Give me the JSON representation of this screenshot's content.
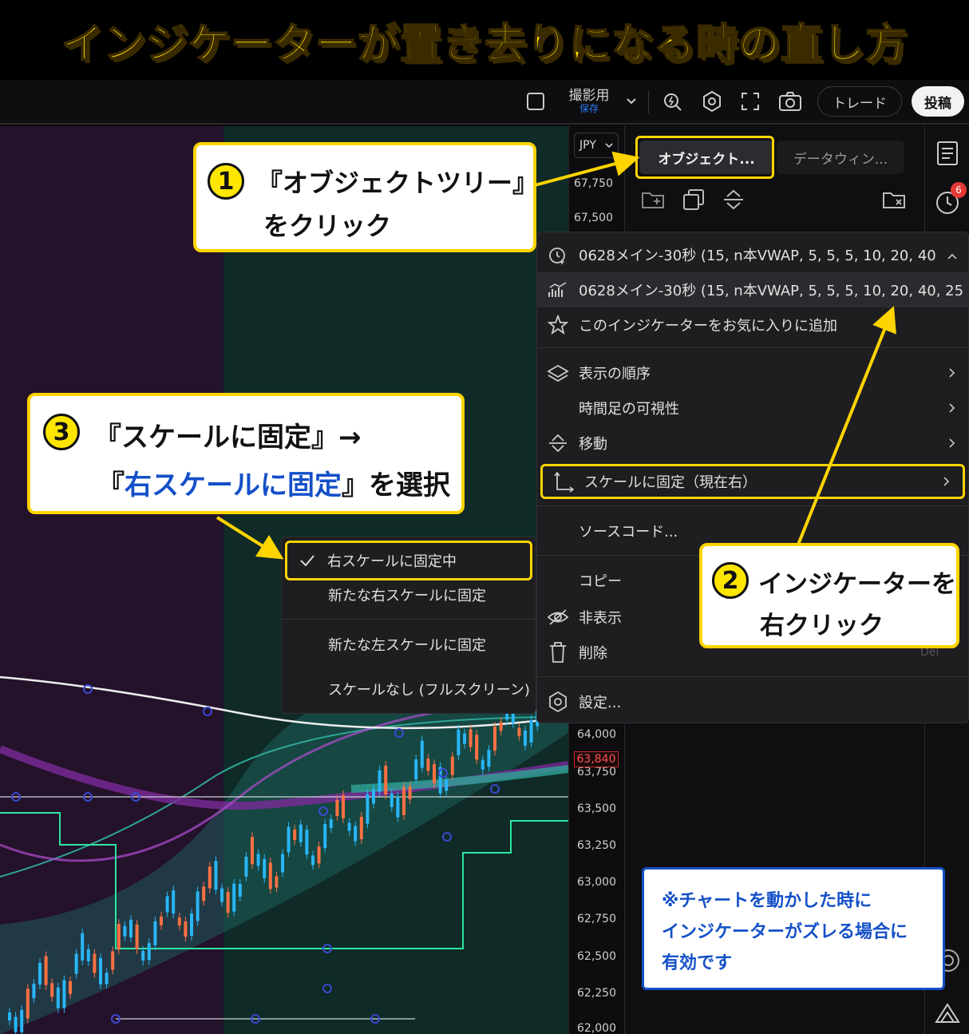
{
  "banner": {
    "title": "インジケーターが置き去りになる時の直し方"
  },
  "topbar": {
    "layout_name": "撮影用",
    "layout_status": "保存",
    "trade_label": "トレード",
    "post_label": "投稿"
  },
  "price_axis": {
    "currency": "JPY",
    "ticks": [
      "67,750",
      "67,500",
      "64,000",
      "63,750",
      "63,500",
      "63,250",
      "63,000",
      "62,750",
      "62,500",
      "62,250",
      "62,000"
    ],
    "current_price": "63,840"
  },
  "panel": {
    "tab_object_tree": "オブジェクト...",
    "tab_data_window": "データウィン..."
  },
  "sidebar": {
    "alert_badge": "6"
  },
  "context_menu": {
    "header_item": "0628メイン-30秒 (15, n本VWAP, 5, 5, 5, 10, 20, 40,",
    "items": [
      {
        "label": "0628メイン-30秒 (15, n本VWAP, 5, 5, 5, 10, 20, 40, 25",
        "icon": "indicator-icon"
      },
      {
        "label": "このインジケーターをお気に入りに追加",
        "icon": "star-icon"
      },
      {
        "label": "表示の順序",
        "icon": "layers-icon"
      },
      {
        "label": "時間足の可視性",
        "icon": ""
      },
      {
        "label": "移動",
        "icon": "move-icon"
      },
      {
        "label": "スケールに固定（現在右）",
        "icon": "pin-scale-icon"
      },
      {
        "label": "ソースコード...",
        "icon": ""
      },
      {
        "label": "コピー",
        "icon": ""
      },
      {
        "label": "非表示",
        "icon": "eye-off-icon"
      },
      {
        "label": "削除",
        "icon": "trash-icon"
      },
      {
        "label": "設定...",
        "icon": "settings-icon"
      }
    ],
    "delete_shortcut": "Del"
  },
  "submenu": {
    "items": [
      {
        "label": "右スケールに固定中",
        "checked": true
      },
      {
        "label": "新たな右スケールに固定"
      },
      {
        "label": "新たな左スケールに固定"
      },
      {
        "label": "スケールなし (フルスクリーン)"
      }
    ]
  },
  "callouts": {
    "step1": {
      "num": "1",
      "line1": "『オブジェクトツリー』",
      "line2": "をクリック"
    },
    "step2": {
      "num": "2",
      "line1": "インジケーターを",
      "line2": "右クリック"
    },
    "step3": {
      "num": "3",
      "line1a": "『スケールに固定』→",
      "line2a": "『",
      "line2b": "右スケールに固定",
      "line2c": "』を選択"
    },
    "note": {
      "line1": "※チャートを動かした時に",
      "line2": "インジケーターがズレる場合に",
      "line3": "有効です"
    }
  },
  "colors": {
    "accent_yellow": "#ffd400",
    "highlight_blue": "#1450c8",
    "candle_up": "#29b6f6",
    "candle_down": "#ff7043"
  }
}
